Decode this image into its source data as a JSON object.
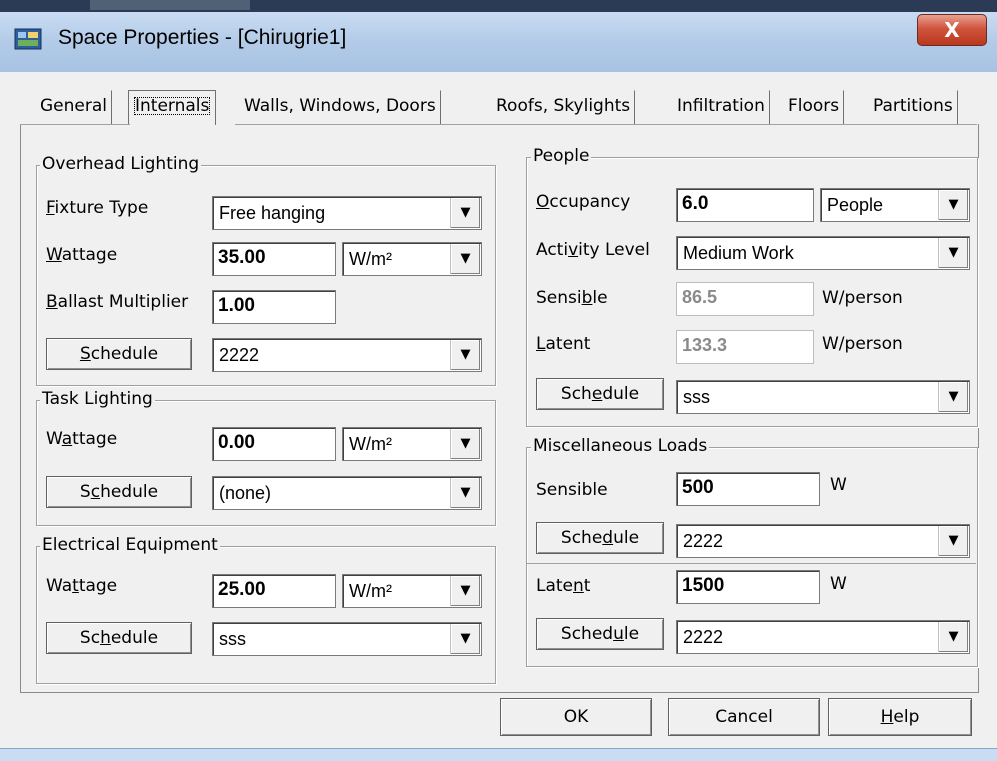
{
  "window": {
    "title": "Space Properties - [Chirugrie1]",
    "close_label": "X"
  },
  "tabs": [
    {
      "label": "General"
    },
    {
      "label": "Internals",
      "active": true
    },
    {
      "label": "Walls, Windows, Doors"
    },
    {
      "label": "Roofs, Skylights"
    },
    {
      "label": "Infiltration"
    },
    {
      "label": "Floors"
    },
    {
      "label": "Partitions"
    }
  ],
  "overhead": {
    "title": "Overhead Lighting",
    "fixture_label": "Fixture Type",
    "fixture_value": "Free hanging",
    "wattage_label": "Wattage",
    "wattage_value": "35.00",
    "wattage_unit": "W/m²",
    "ballast_label": "Ballast Multiplier",
    "ballast_value": "1.00",
    "schedule_label": "Schedule",
    "schedule_value": "2222"
  },
  "task": {
    "title": "Task Lighting",
    "wattage_label": "Wattage",
    "wattage_value": "0.00",
    "wattage_unit": "W/m²",
    "schedule_label": "Schedule",
    "schedule_value": "(none)"
  },
  "electrical": {
    "title": "Electrical Equipment",
    "wattage_label": "Wattage",
    "wattage_value": "25.00",
    "wattage_unit": "W/m²",
    "schedule_label": "Schedule",
    "schedule_value": "sss"
  },
  "people": {
    "title": "People",
    "occupancy_label": "Occupancy",
    "occupancy_value": "6.0",
    "occupancy_unit": "People",
    "activity_label": "Activity Level",
    "activity_value": "Medium Work",
    "sensible_label": "Sensible",
    "sensible_value": "86.5",
    "sensible_unit": "W/person",
    "latent_label": "Latent",
    "latent_value": "133.3",
    "latent_unit": "W/person",
    "schedule_label": "Schedule",
    "schedule_value": "sss"
  },
  "misc": {
    "title": "Miscellaneous Loads",
    "sensible_label": "Sensible",
    "sensible_value": "500",
    "sensible_unit": "W",
    "sensible_schedule_label": "Schedule",
    "sensible_schedule_value": "2222",
    "latent_label": "Latent",
    "latent_value": "1500",
    "latent_unit": "W",
    "latent_schedule_label": "Schedule",
    "latent_schedule_value": "2222"
  },
  "buttons": {
    "ok": "OK",
    "cancel": "Cancel",
    "help": "Help"
  },
  "colors": {
    "titlebar": "#b3cbe8",
    "close": "#c7452b",
    "dialog_bg": "#f0f0f0"
  }
}
